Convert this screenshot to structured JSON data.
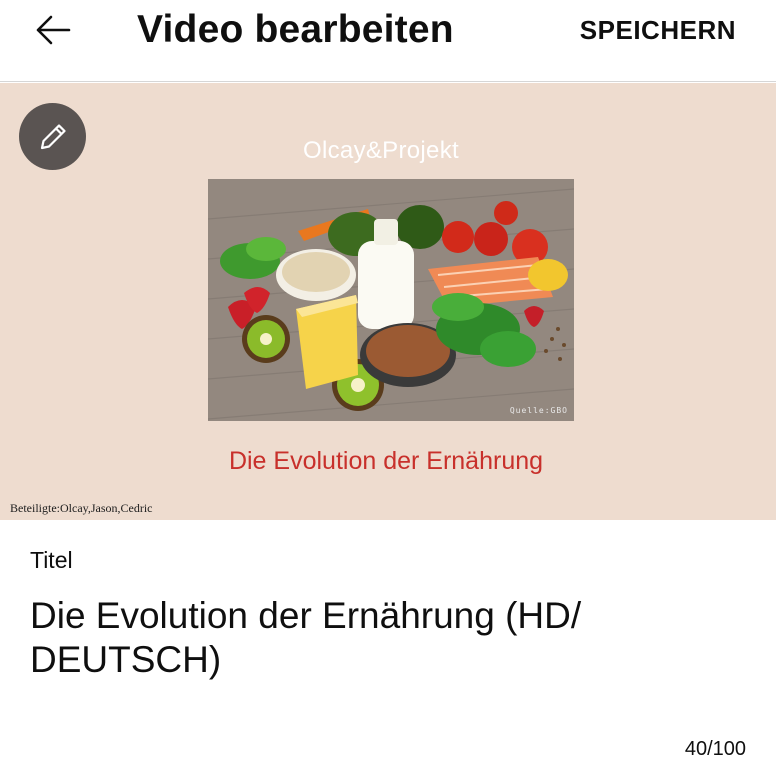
{
  "header": {
    "title": "Video bearbeiten",
    "save_label": "SPEICHERN",
    "back_icon": "arrow-left-icon"
  },
  "thumbnail": {
    "edit_icon": "pencil-icon",
    "channel_name": "Olcay&Projekt",
    "photo_credit": "Quelle:GBO",
    "caption": "Die Evolution der Ernährung",
    "contributors": "Beteiligte:Olcay,Jason,Cedric",
    "caption_color": "#c8302b",
    "background_color": "#eedccf"
  },
  "title_field": {
    "label": "Titel",
    "value": "Die Evolution der Ernährung (HD/ DEUTSCH)",
    "char_count": "40/100"
  }
}
